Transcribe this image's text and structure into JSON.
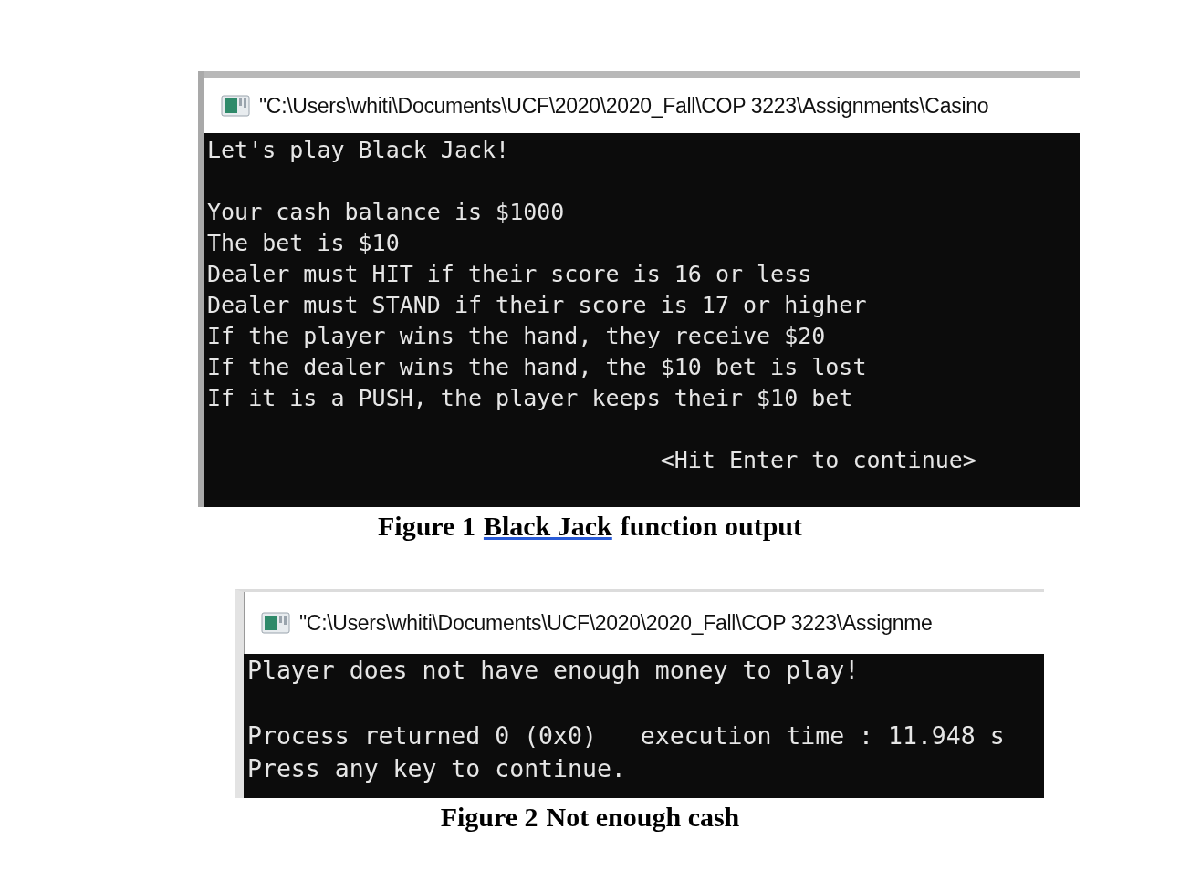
{
  "figures": [
    {
      "window": {
        "title": "\"C:\\Users\\whiti\\Documents\\UCF\\2020\\2020_Fall\\COP 3223\\Assignments\\Casino"
      },
      "console": [
        {
          "kind": "text",
          "text": "Let's play Black Jack!"
        },
        {
          "kind": "blank"
        },
        {
          "kind": "text",
          "text": "Your cash balance is $1000"
        },
        {
          "kind": "text",
          "text": "The bet is $10"
        },
        {
          "kind": "text",
          "text": "Dealer must HIT if their score is 16 or less"
        },
        {
          "kind": "text",
          "text": "Dealer must STAND if their score is 17 or higher"
        },
        {
          "kind": "text",
          "text": "If the player wins the hand, they receive $20"
        },
        {
          "kind": "text",
          "text": "If the dealer wins the hand, the $10 bet is lost"
        },
        {
          "kind": "text",
          "text": "If it is a PUSH, the player keeps their $10 bet"
        },
        {
          "kind": "blank"
        },
        {
          "kind": "prompt",
          "text": "<Hit Enter to continue>"
        }
      ],
      "caption": [
        {
          "text": "Figure 1",
          "underlined": false
        },
        {
          "text": "Black Jack",
          "underlined": true
        },
        {
          "text": "function output",
          "underlined": false
        }
      ]
    },
    {
      "window": {
        "title": "\"C:\\Users\\whiti\\Documents\\UCF\\2020\\2020_Fall\\COP 3223\\Assignme"
      },
      "console": [
        {
          "kind": "text",
          "text": "Player does not have enough money to play!"
        },
        {
          "kind": "blank"
        },
        {
          "kind": "text",
          "text": "Process returned 0 (0x0)   execution time : 11.948 s"
        },
        {
          "kind": "text",
          "text": "Press any key to continue."
        }
      ],
      "caption": [
        {
          "text": "Figure 2",
          "underlined": false
        },
        {
          "text": "Not enough cash",
          "underlined": false
        }
      ]
    }
  ]
}
